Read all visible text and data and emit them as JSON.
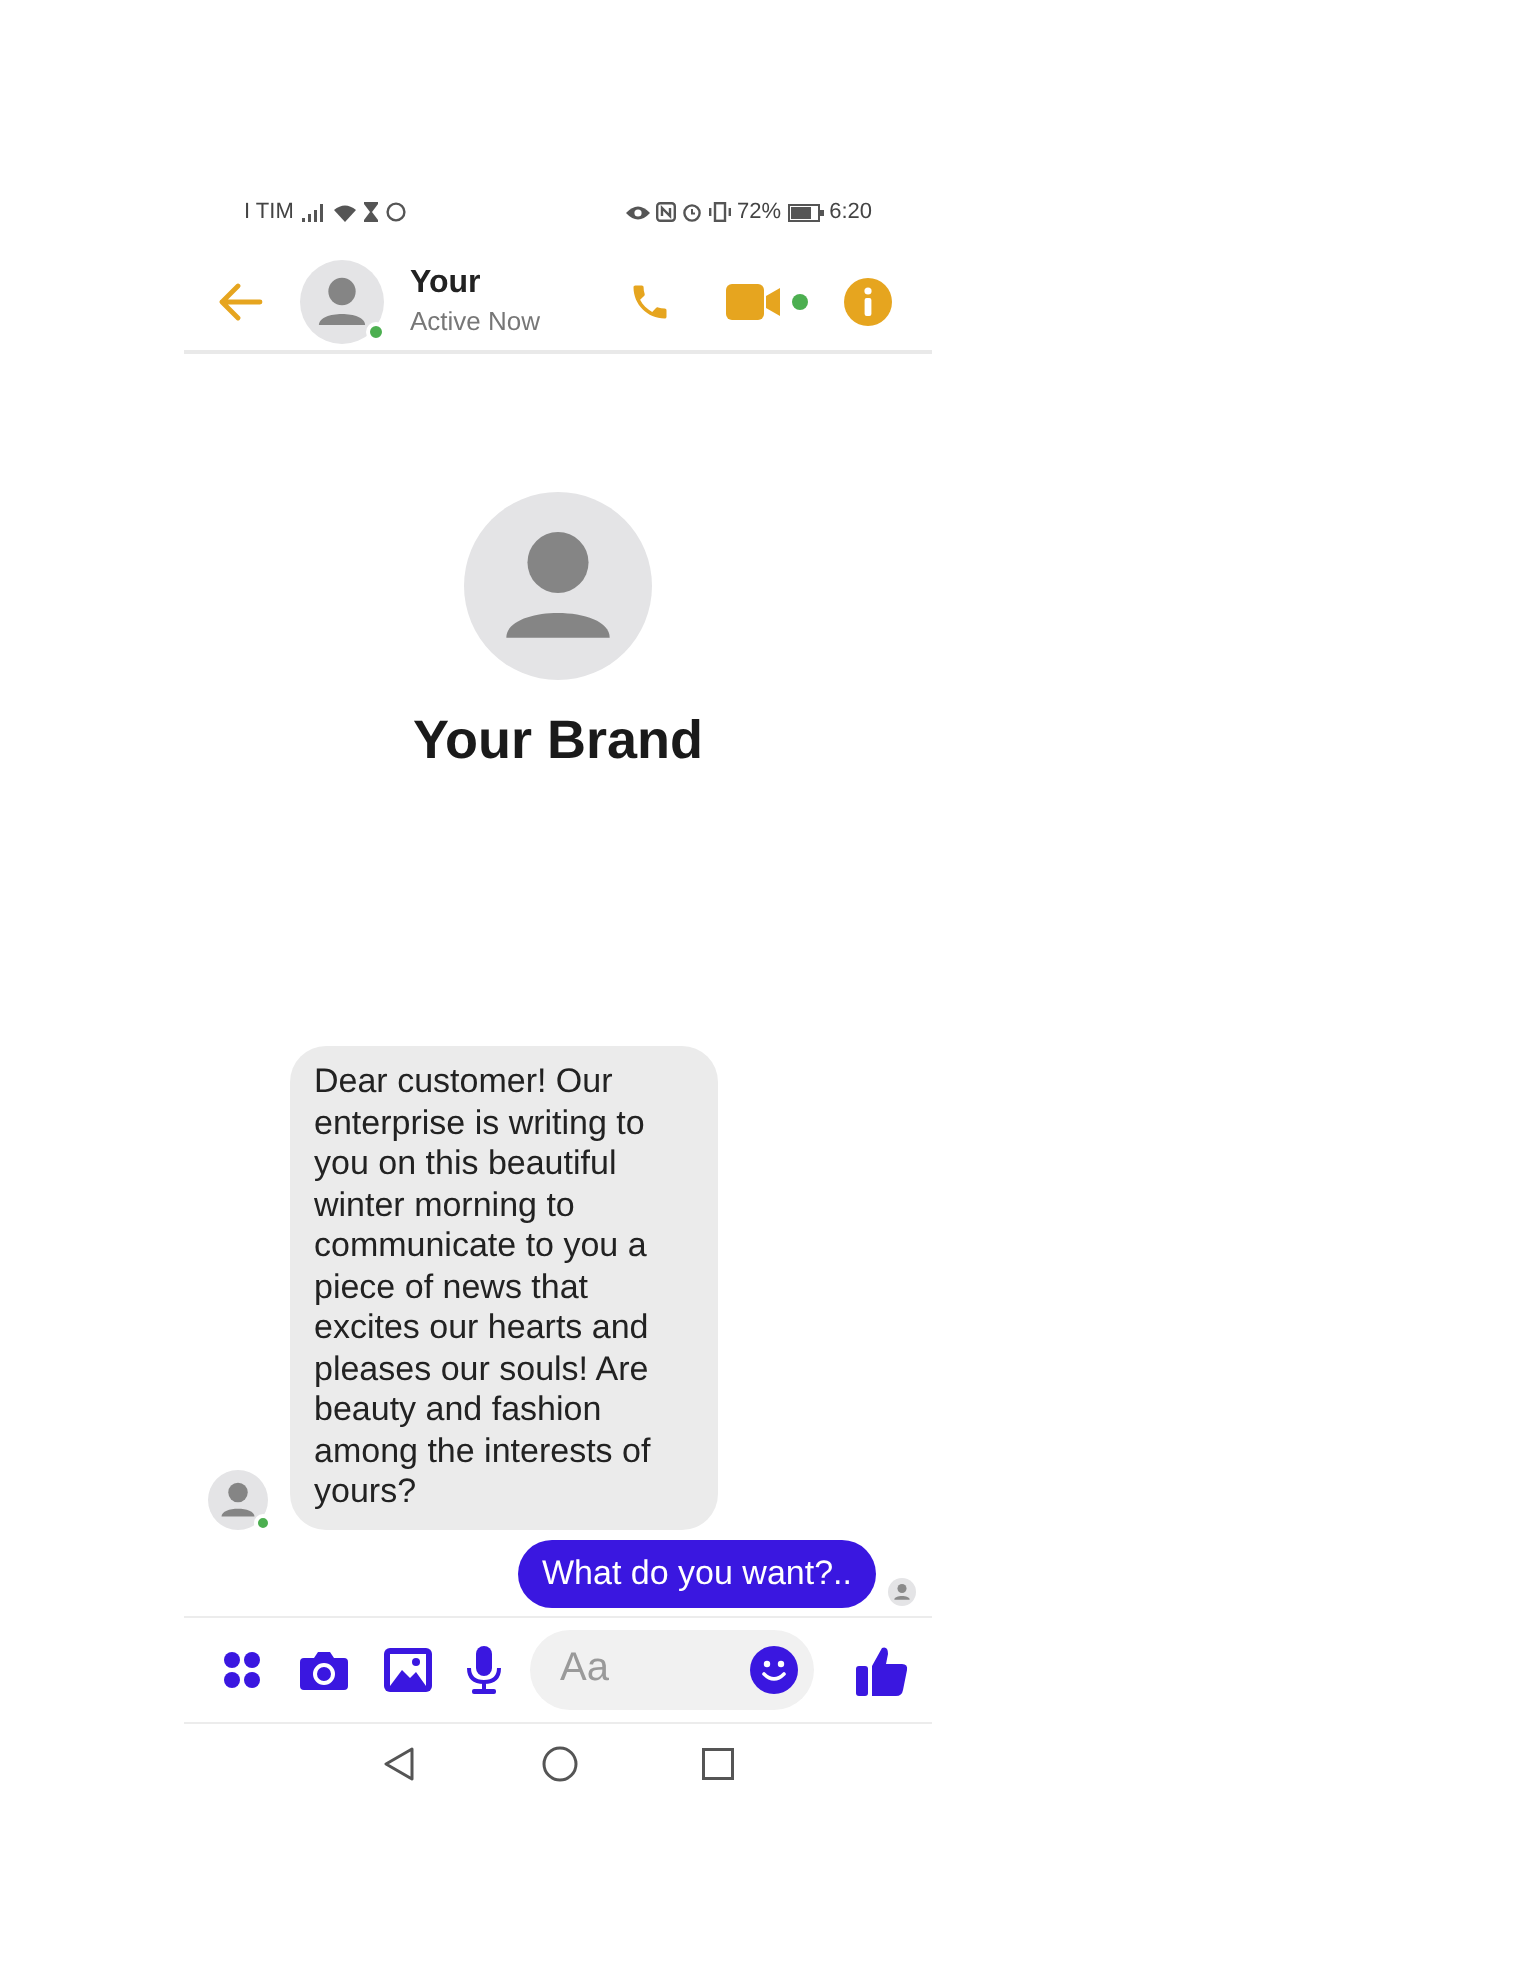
{
  "status_bar": {
    "carrier": "I TIM",
    "battery_percent": "72%",
    "time": "6:20"
  },
  "header": {
    "contact_name": "Your",
    "status": "Active Now",
    "online": true,
    "video_online": true
  },
  "profile": {
    "name": "Your Brand"
  },
  "messages": [
    {
      "kind": "incoming",
      "text": "Dear customer! Our enterprise is writing to you on this beautiful winter morning to communicate to you a piece of news that excites our hearts and pleases our souls! Are beauty and fashion among the interests of yours?",
      "online": true
    },
    {
      "kind": "outgoing",
      "text": "What do you want?..",
      "seen": true
    }
  ],
  "composer": {
    "placeholder": "Aa"
  }
}
